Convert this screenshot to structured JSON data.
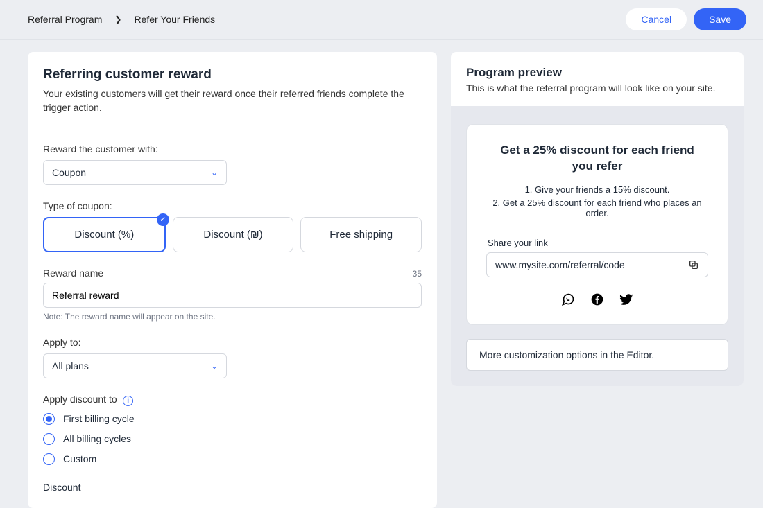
{
  "breadcrumb": {
    "root": "Referral Program",
    "current": "Refer Your Friends"
  },
  "actions": {
    "cancel": "Cancel",
    "save": "Save"
  },
  "form": {
    "title": "Referring customer reward",
    "subtitle": "Your existing customers will get their reward once their referred friends complete the trigger action.",
    "reward_with_label": "Reward the customer with:",
    "reward_with_value": "Coupon",
    "coupon_type_label": "Type of coupon:",
    "coupon_types": {
      "pct": "Discount (%)",
      "cur": "Discount (₪)",
      "ship": "Free shipping"
    },
    "reward_name_label": "Reward name",
    "reward_name_value": "Referral reward",
    "reward_name_counter": "35",
    "reward_name_note": "Note: The reward name will appear on the site.",
    "apply_to_label": "Apply to:",
    "apply_to_value": "All plans",
    "apply_discount_label": "Apply discount to",
    "cycles": {
      "first": "First billing cycle",
      "all": "All billing cycles",
      "custom": "Custom"
    },
    "discount_label": "Discount"
  },
  "preview": {
    "title": "Program preview",
    "subtitle": "This is what the referral program will look like on your site.",
    "widget_title": "Get a 25% discount for each friend you refer",
    "inst1": "1. Give your friends a 15% discount.",
    "inst2": "2. Get a 25% discount for each friend who places an order.",
    "share_label": "Share your link",
    "share_url": "www.mysite.com/referral/code",
    "editor_note": "More customization options in the Editor."
  }
}
